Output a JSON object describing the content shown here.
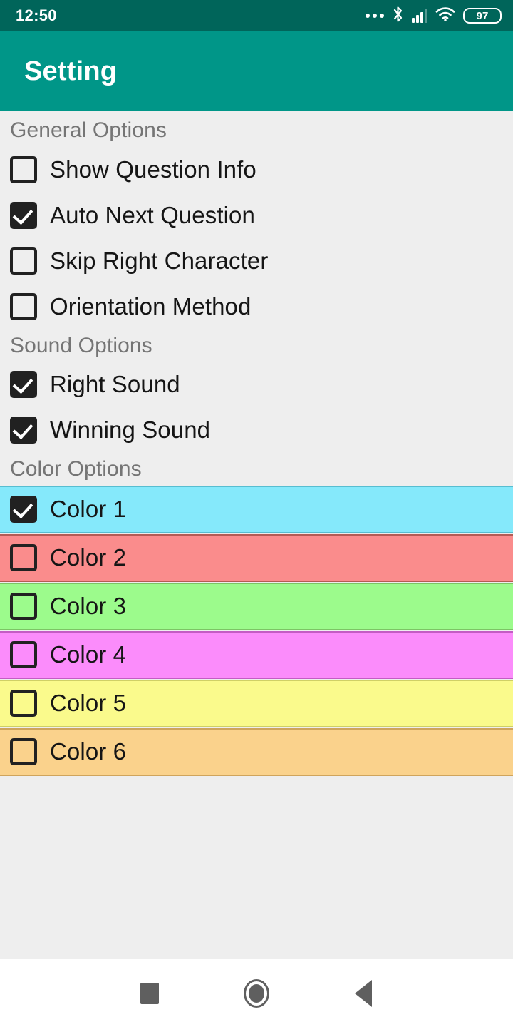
{
  "status_bar": {
    "time": "12:50",
    "battery_level": "97",
    "icons": [
      "more-dots-icon",
      "bluetooth-icon",
      "cellular-signal-icon",
      "wifi-icon",
      "battery-icon"
    ],
    "background_color": "#00655A"
  },
  "app_bar": {
    "title": "Setting",
    "background_color": "#009688",
    "title_color": "#FFFFFF"
  },
  "sections": [
    {
      "header": "General Options",
      "items": [
        {
          "label": "Show Question Info",
          "checked": false
        },
        {
          "label": "Auto Next Question",
          "checked": true
        },
        {
          "label": "Skip Right Character",
          "checked": false
        },
        {
          "label": "Orientation Method",
          "checked": false
        }
      ]
    },
    {
      "header": "Sound Options",
      "items": [
        {
          "label": "Right Sound",
          "checked": true
        },
        {
          "label": "Winning Sound",
          "checked": true
        }
      ]
    }
  ],
  "color_section": {
    "header": "Color Options",
    "items": [
      {
        "label": "Color 1",
        "checked": true,
        "background_color": "#85E9FB",
        "border_color": "#57BDD0"
      },
      {
        "label": "Color 2",
        "checked": false,
        "background_color": "#FA8C8C",
        "border_color": "#B45C55"
      },
      {
        "label": "Color 3",
        "checked": false,
        "background_color": "#9CFB8C",
        "border_color": "#7CC465"
      },
      {
        "label": "Color 4",
        "checked": false,
        "background_color": "#FB8CFB",
        "border_color": "#C45CC4"
      },
      {
        "label": "Color 5",
        "checked": false,
        "background_color": "#FAFA8C",
        "border_color": "#CFCF66"
      },
      {
        "label": "Color 6",
        "checked": false,
        "background_color": "#FAD28C",
        "border_color": "#CFA45C"
      }
    ]
  },
  "nav_bar": {
    "buttons": [
      {
        "name": "recents-button",
        "icon": "square-icon"
      },
      {
        "name": "home-button",
        "icon": "circle-icon"
      },
      {
        "name": "back-button",
        "icon": "triangle-left-icon"
      }
    ],
    "background_color": "#FFFFFF",
    "icon_color": "#5F5F5F"
  },
  "theme": {
    "content_background": "#EEEEEE",
    "section_header_color": "#757575",
    "label_color": "#151515",
    "checkbox_color": "#212121"
  }
}
